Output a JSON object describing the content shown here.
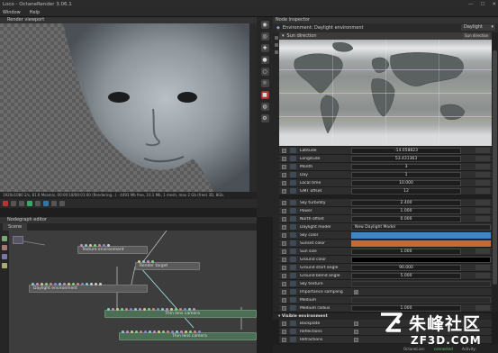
{
  "app": {
    "title": "Loco - OctaneRender 3.06.1",
    "menu": [
      "Window",
      "Help"
    ]
  },
  "render_viewport": {
    "title": "Render viewport",
    "status": "1920x1080 2/s, 81.6 Msam/s, 00:00:18/00:01:00 (Rendering...) · 4493 Mb free, 10.1 Mb, 1 mesh, max 2 Gb (free) 3D, 8Gb."
  },
  "nodegraph": {
    "title": "Nodegraph editor",
    "tab": "Scene",
    "nodes": [
      {
        "label": "Texture environment",
        "kind": "grey"
      },
      {
        "label": "Render target",
        "kind": "grey"
      },
      {
        "label": "Daylight environment",
        "kind": "grey"
      },
      {
        "label": "Thin lens camera",
        "kind": "green"
      },
      {
        "label": "Thin lens camera",
        "kind": "green"
      }
    ]
  },
  "inspector": {
    "title": "Node inspector",
    "header": "Environment: Daylight environment",
    "dropdown": "Daylight",
    "sun_direction": {
      "label": "Sun direction",
      "pill": "Sun direction"
    },
    "sun_params": [
      {
        "label": "Latitude",
        "value": "-14.058823"
      },
      {
        "label": "Longitude",
        "value": "53.431363"
      },
      {
        "label": "Month",
        "value": "3"
      },
      {
        "label": "Day",
        "value": "1"
      },
      {
        "label": "Local time",
        "value": "10.000"
      },
      {
        "label": "GMT offset",
        "value": "12"
      }
    ],
    "params": [
      {
        "label": "Sky turbidity",
        "value": "2.400",
        "type": "num"
      },
      {
        "label": "Power",
        "value": "1.000",
        "type": "num"
      },
      {
        "label": "North offset",
        "value": "0.000",
        "type": "num"
      },
      {
        "label": "Daylight model",
        "value": "New Daylight Model",
        "type": "text"
      },
      {
        "label": "Sky color",
        "value": "",
        "type": "swatch",
        "color": "#3e86cc"
      },
      {
        "label": "Sunset color",
        "value": "",
        "type": "swatch",
        "color": "#c86a34"
      },
      {
        "label": "Sun size",
        "value": "1.000",
        "type": "num"
      },
      {
        "label": "Ground color",
        "value": "",
        "type": "swatch",
        "color": "#000000"
      },
      {
        "label": "Ground start angle",
        "value": "90.000",
        "type": "num"
      },
      {
        "label": "Ground blend angle",
        "value": "5.000",
        "type": "num"
      },
      {
        "label": "Sky texture",
        "value": "",
        "type": "bar"
      },
      {
        "label": "Importance sampling",
        "value": "",
        "type": "check"
      },
      {
        "label": "Medium",
        "value": "",
        "type": "bar"
      },
      {
        "label": "Medium radius",
        "value": "1.000",
        "type": "num"
      }
    ],
    "visible_section": "Visible environment",
    "visible_items": [
      {
        "label": "Backplate"
      },
      {
        "label": "Reflections"
      },
      {
        "label": "Refractions"
      }
    ],
    "status": [
      "OctaneLive:",
      "connected",
      "Activity:"
    ]
  },
  "watermark": {
    "cn": "朱峰社区",
    "en": "ZF3D.COM"
  },
  "colors": {
    "sky": "#3e86cc",
    "sunset": "#c86a34",
    "connected": "#66cc66"
  }
}
